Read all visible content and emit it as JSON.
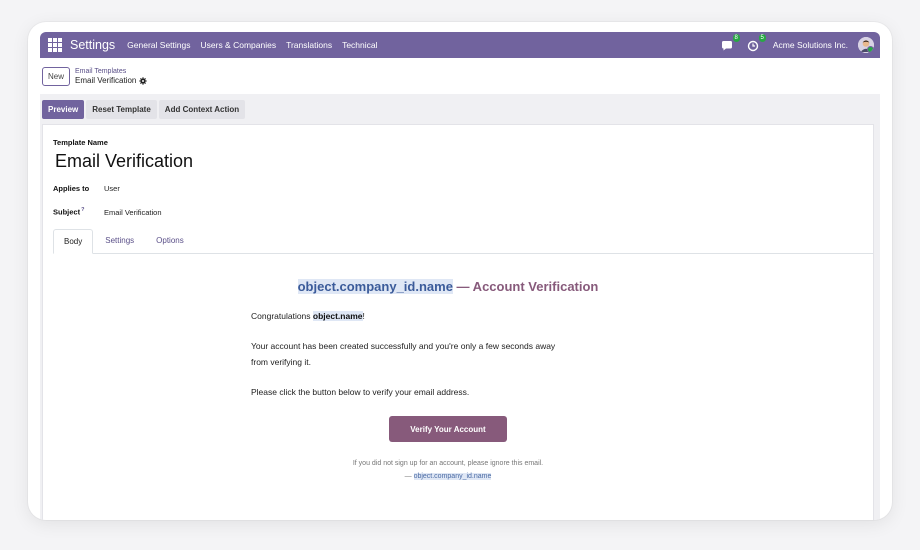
{
  "navbar": {
    "app_name": "Settings",
    "menu": [
      "General Settings",
      "Users & Companies",
      "Translations",
      "Technical"
    ],
    "messages_count": "8",
    "activities_count": "5",
    "company": "Acme Solutions Inc.",
    "color": "#71639e"
  },
  "control": {
    "new_label": "New",
    "breadcrumb_parent": "Email Templates",
    "breadcrumb_current": "Email Verification"
  },
  "statusbar": {
    "preview_label": "Preview",
    "reset_label": "Reset Template",
    "context_label": "Add Context Action"
  },
  "form": {
    "template_name_label": "Template Name",
    "template_name": "Email Verification",
    "applies_to_label": "Applies to",
    "applies_to": "User",
    "subject_label": "Subject",
    "subject_help": "?",
    "subject": "Email Verification"
  },
  "tabs": [
    "Body",
    "Settings",
    "Options"
  ],
  "email": {
    "title_placeholder": "object.company_id.name",
    "title_suffix": " — Account Verification",
    "greeting_prefix": "Congratulations ",
    "greeting_placeholder": "object.name",
    "greeting_suffix": "!",
    "para1_line1": "Your account has been created successfully and you're only a few seconds away",
    "para1_line2": "from verifying it.",
    "para2": "Please click the button below to verify your email address.",
    "button_label": "Verify Your Account",
    "footer_line1": "If you did not sign up for an account, please ignore this email.",
    "footer_prefix": "— ",
    "footer_placeholder": "object.company_id.name",
    "accent_color": "#875a7b"
  }
}
